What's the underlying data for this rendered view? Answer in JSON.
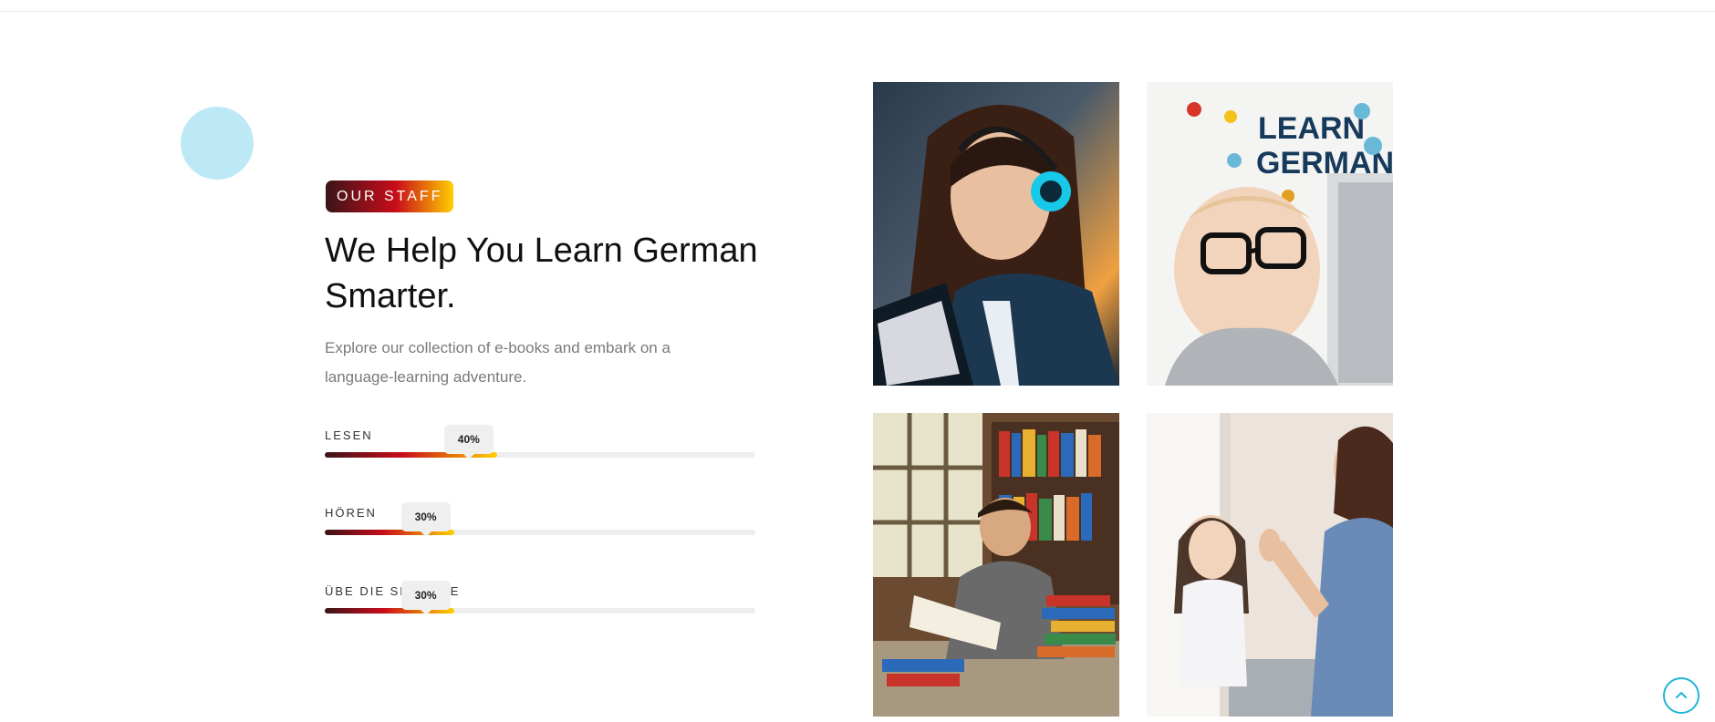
{
  "section": {
    "tag_label": "OUR STAFF",
    "heading": "We Help You Learn German Smarter.",
    "description": "Explore our collection of e-books and embark on a language-learning adventure."
  },
  "skills": [
    {
      "label": "LESEN",
      "percent_label": "40%",
      "value": 40
    },
    {
      "label": "HÖREN",
      "percent_label": "30%",
      "value": 30
    },
    {
      "label": "ÜBE DIE SPRACHE",
      "percent_label": "30%",
      "value": 30
    }
  ],
  "images": [
    {
      "name": "girl-with-headphones-reading-image"
    },
    {
      "name": "child-learn-german-image",
      "caption_line1": "LEARN",
      "caption_line2": "GERMAN"
    },
    {
      "name": "boy-reading-among-books-image"
    },
    {
      "name": "girl-and-teacher-image"
    }
  ],
  "colors": {
    "accent_cyan": "#1fb5d6",
    "decor_circle": "#bde9f7",
    "gradient_start": "#3b1418",
    "gradient_mid": "#c90d1a",
    "gradient_end": "#ffcf00"
  },
  "icons": {
    "scroll_top": "chevron-up-icon"
  }
}
